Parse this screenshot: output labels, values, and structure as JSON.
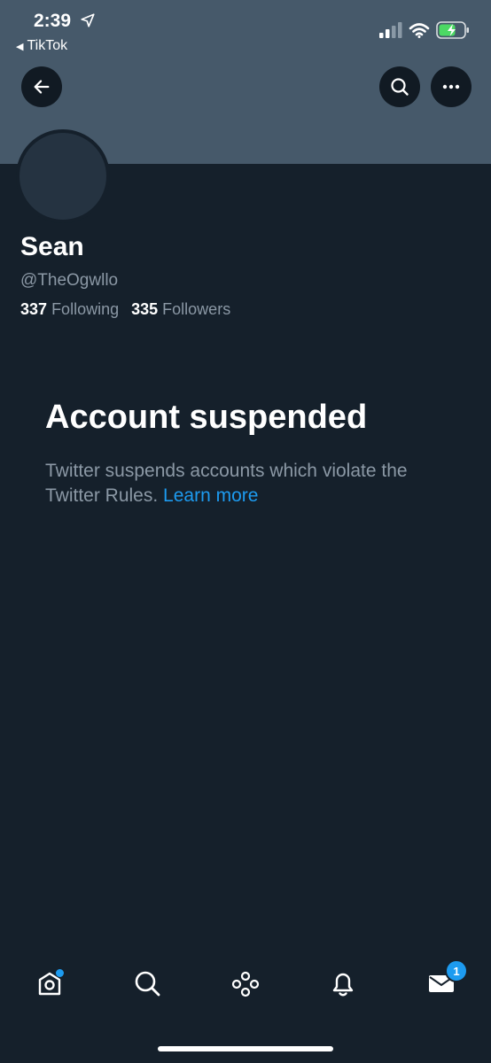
{
  "status_bar": {
    "time": "2:39",
    "back_app": "TikTok"
  },
  "profile": {
    "name": "Sean",
    "handle": "@TheOgwllo",
    "following_count": "337",
    "following_label": "Following",
    "followers_count": "335",
    "followers_label": "Followers"
  },
  "suspension": {
    "title": "Account suspended",
    "message": "Twitter suspends accounts which violate the Twitter Rules.",
    "link": "Learn more"
  },
  "tabbar": {
    "items": [
      {
        "icon": "home-icon",
        "has_dot": true
      },
      {
        "icon": "search-icon"
      },
      {
        "icon": "spaces-icon"
      },
      {
        "icon": "bell-icon"
      },
      {
        "icon": "mail-icon",
        "badge": "1"
      }
    ]
  },
  "colors": {
    "background": "#15202b",
    "banner": "#46596a",
    "accent": "#1d9bf0",
    "secondary_text": "#8b98a5"
  }
}
